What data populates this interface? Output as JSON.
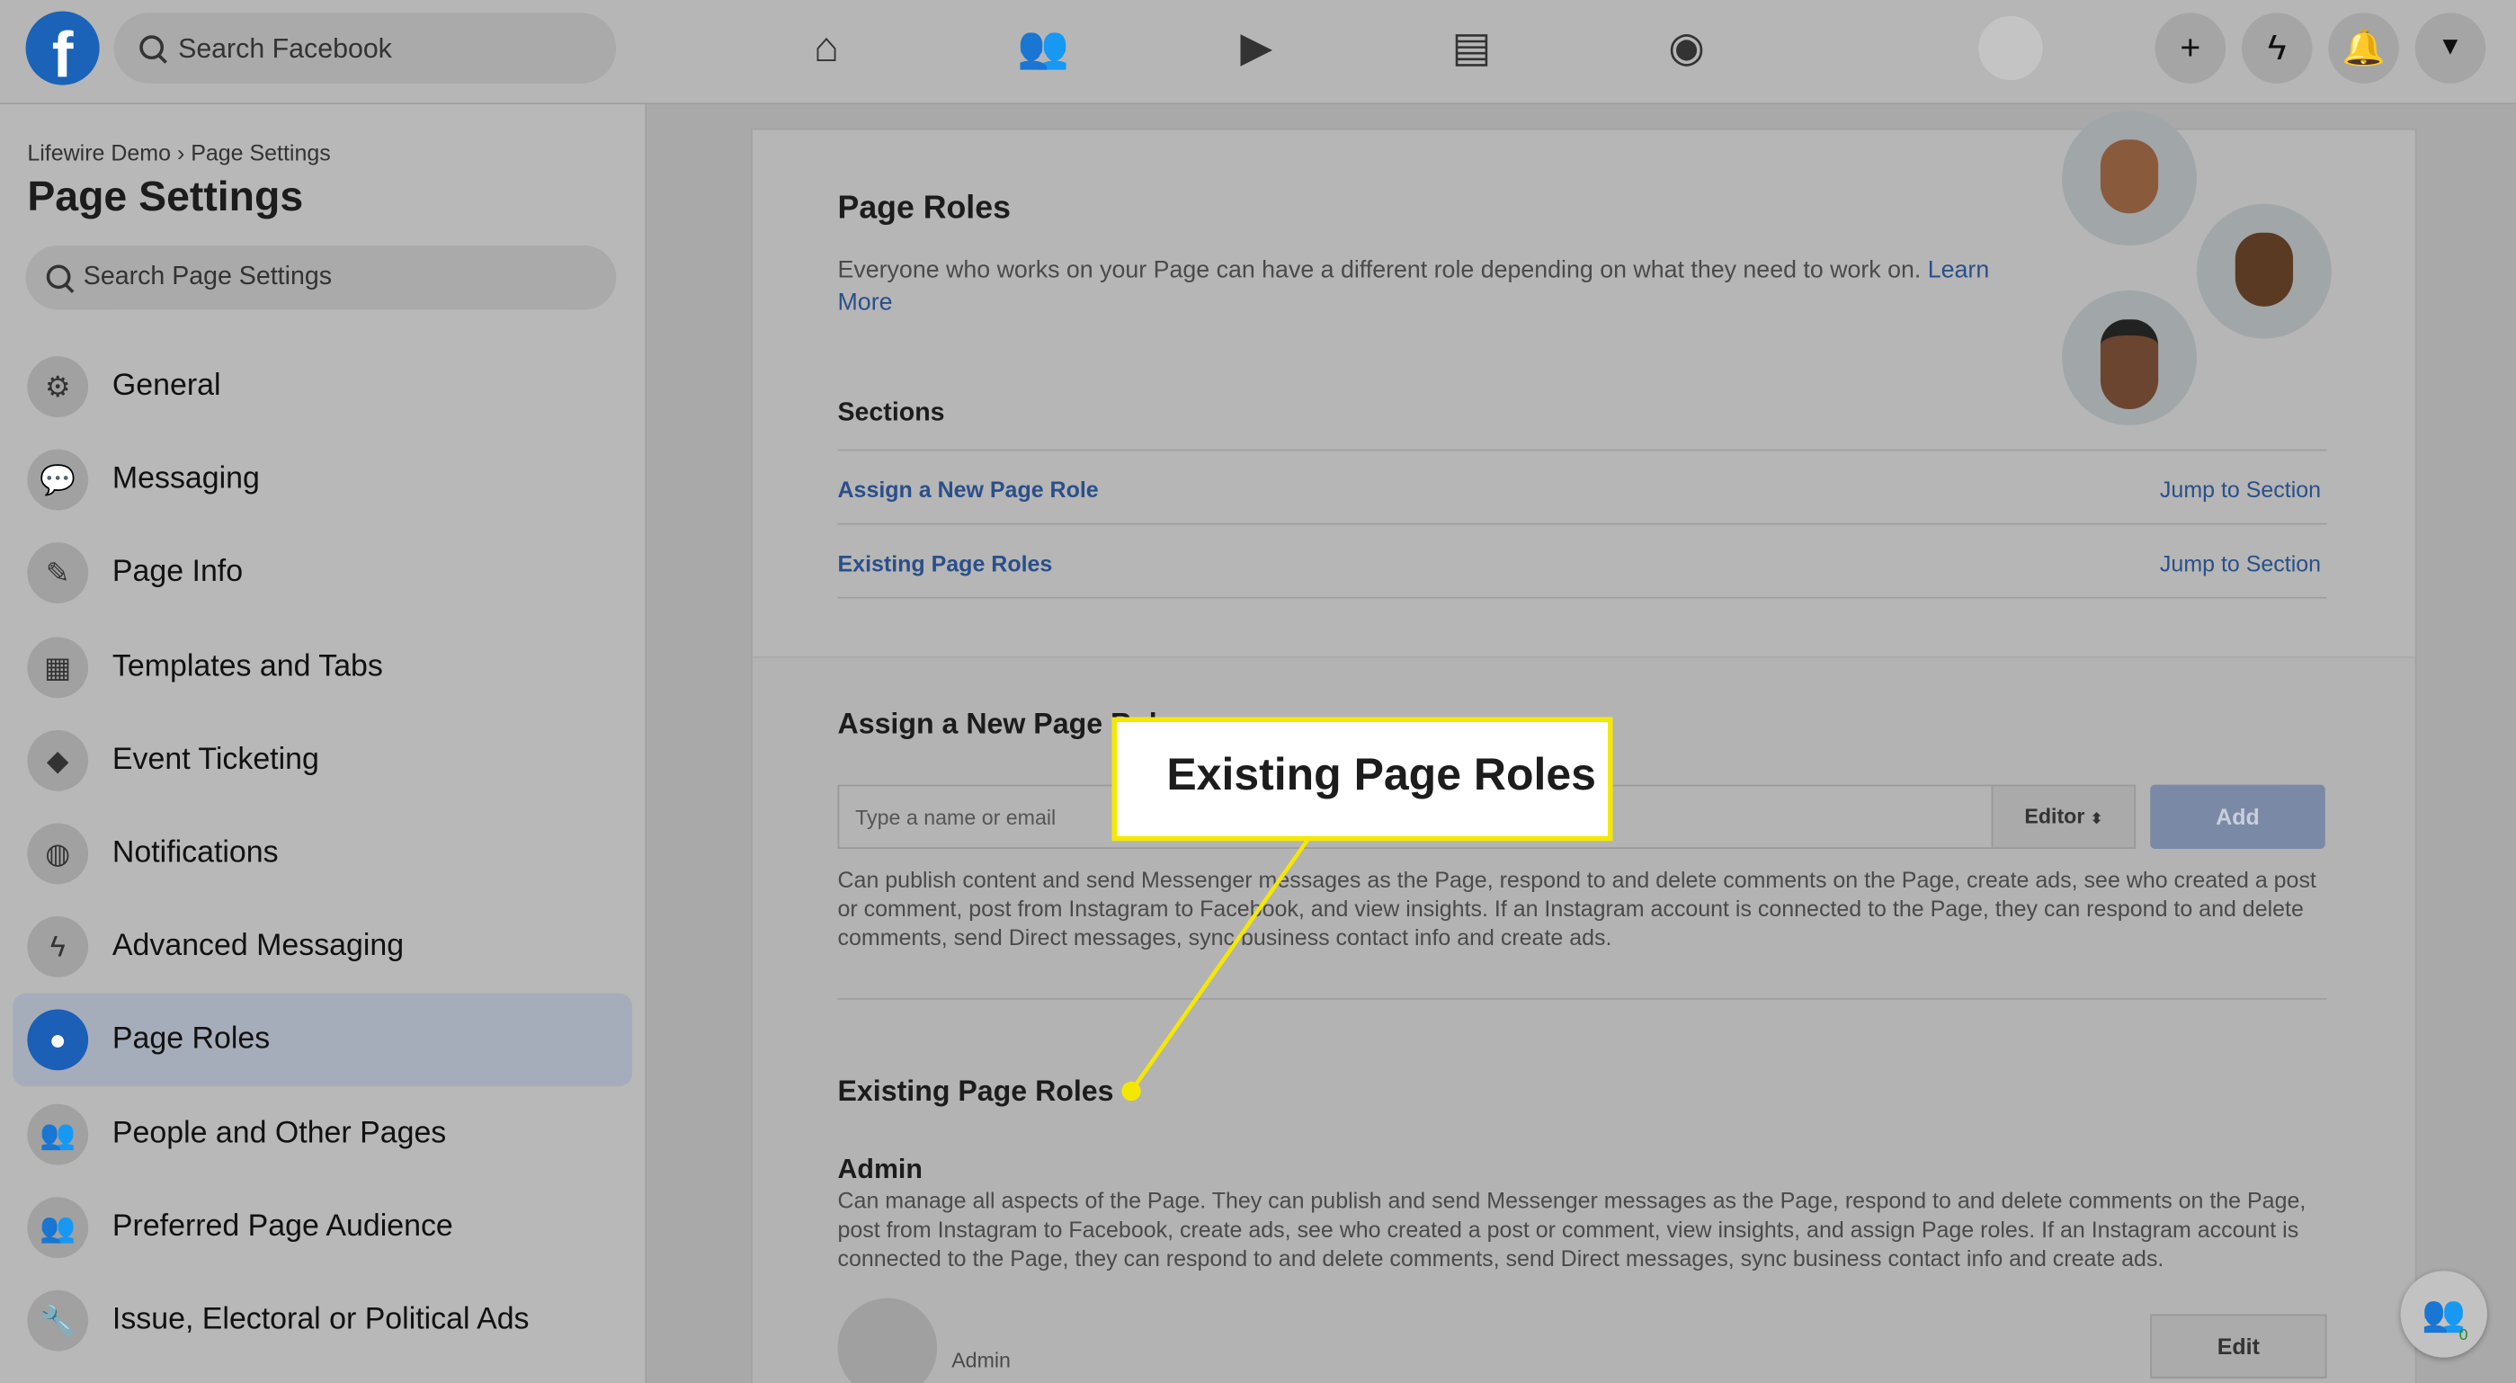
{
  "topbar": {
    "search_placeholder": "Search Facebook",
    "logo": "f",
    "nav_icons": [
      "home-icon",
      "friends-icon",
      "watch-icon",
      "marketplace-icon",
      "groups-icon"
    ],
    "right_icons": [
      "plus-icon",
      "messenger-icon",
      "notifications-icon",
      "menu-caret-icon"
    ]
  },
  "sidebar": {
    "breadcrumb": "Lifewire Demo › Page Settings",
    "title": "Page Settings",
    "search_placeholder": "Search Page Settings",
    "items": [
      {
        "label": "General",
        "icon": "gear-icon",
        "glyph": "⚙"
      },
      {
        "label": "Messaging",
        "icon": "chat-icon",
        "glyph": "💬"
      },
      {
        "label": "Page Info",
        "icon": "pencil-icon",
        "glyph": "✎"
      },
      {
        "label": "Templates and Tabs",
        "icon": "grid-icon",
        "glyph": "▦"
      },
      {
        "label": "Event Ticketing",
        "icon": "ticket-icon",
        "glyph": "◆"
      },
      {
        "label": "Notifications",
        "icon": "globe-icon",
        "glyph": "◍"
      },
      {
        "label": "Advanced Messaging",
        "icon": "messenger-icon",
        "glyph": "ϟ"
      },
      {
        "label": "Page Roles",
        "icon": "person-icon",
        "glyph": "●",
        "selected": true
      },
      {
        "label": "People and Other Pages",
        "icon": "people-icon",
        "glyph": "👥"
      },
      {
        "label": "Preferred Page Audience",
        "icon": "people-icon",
        "glyph": "👥"
      },
      {
        "label": "Issue, Electoral or Political Ads",
        "icon": "wrench-icon",
        "glyph": "🔧"
      }
    ]
  },
  "main": {
    "title": "Page Roles",
    "intro": "Everyone who works on your Page can have a different role depending on what they need to work on.",
    "learn_more": "Learn More",
    "sections_title": "Sections",
    "sections": [
      {
        "label": "Assign a New Page Role",
        "jump": "Jump to Section"
      },
      {
        "label": "Existing Page Roles",
        "jump": "Jump to Section"
      }
    ],
    "assign_title": "Assign a New Page Role",
    "input_placeholder": "Type a name or email",
    "role_select": "Editor",
    "add_label": "Add",
    "editor_desc": "Can publish content and send Messenger messages as the Page, respond to and delete comments on the Page, create ads, see who created a post or comment, post from Instagram to Facebook, and view insights. If an Instagram account is connected to the Page, they can respond to and delete comments, send Direct messages, sync business contact info and create ads.",
    "existing_title": "Existing Page Roles",
    "admin_title": "Admin",
    "admin_desc": "Can manage all aspects of the Page. They can publish and send Messenger messages as the Page, respond to and delete comments on the Page, post from Instagram to Facebook, create ads, see who created a post or comment, view insights, and assign Page roles. If an Instagram account is connected to the Page, they can respond to and delete comments, send Direct messages, sync business contact info and create ads.",
    "admin_role": "Admin",
    "edit_label": "Edit"
  },
  "callout": {
    "text": "Existing Page Roles",
    "color": "#f5e800"
  },
  "fab": {
    "badge": "0"
  }
}
